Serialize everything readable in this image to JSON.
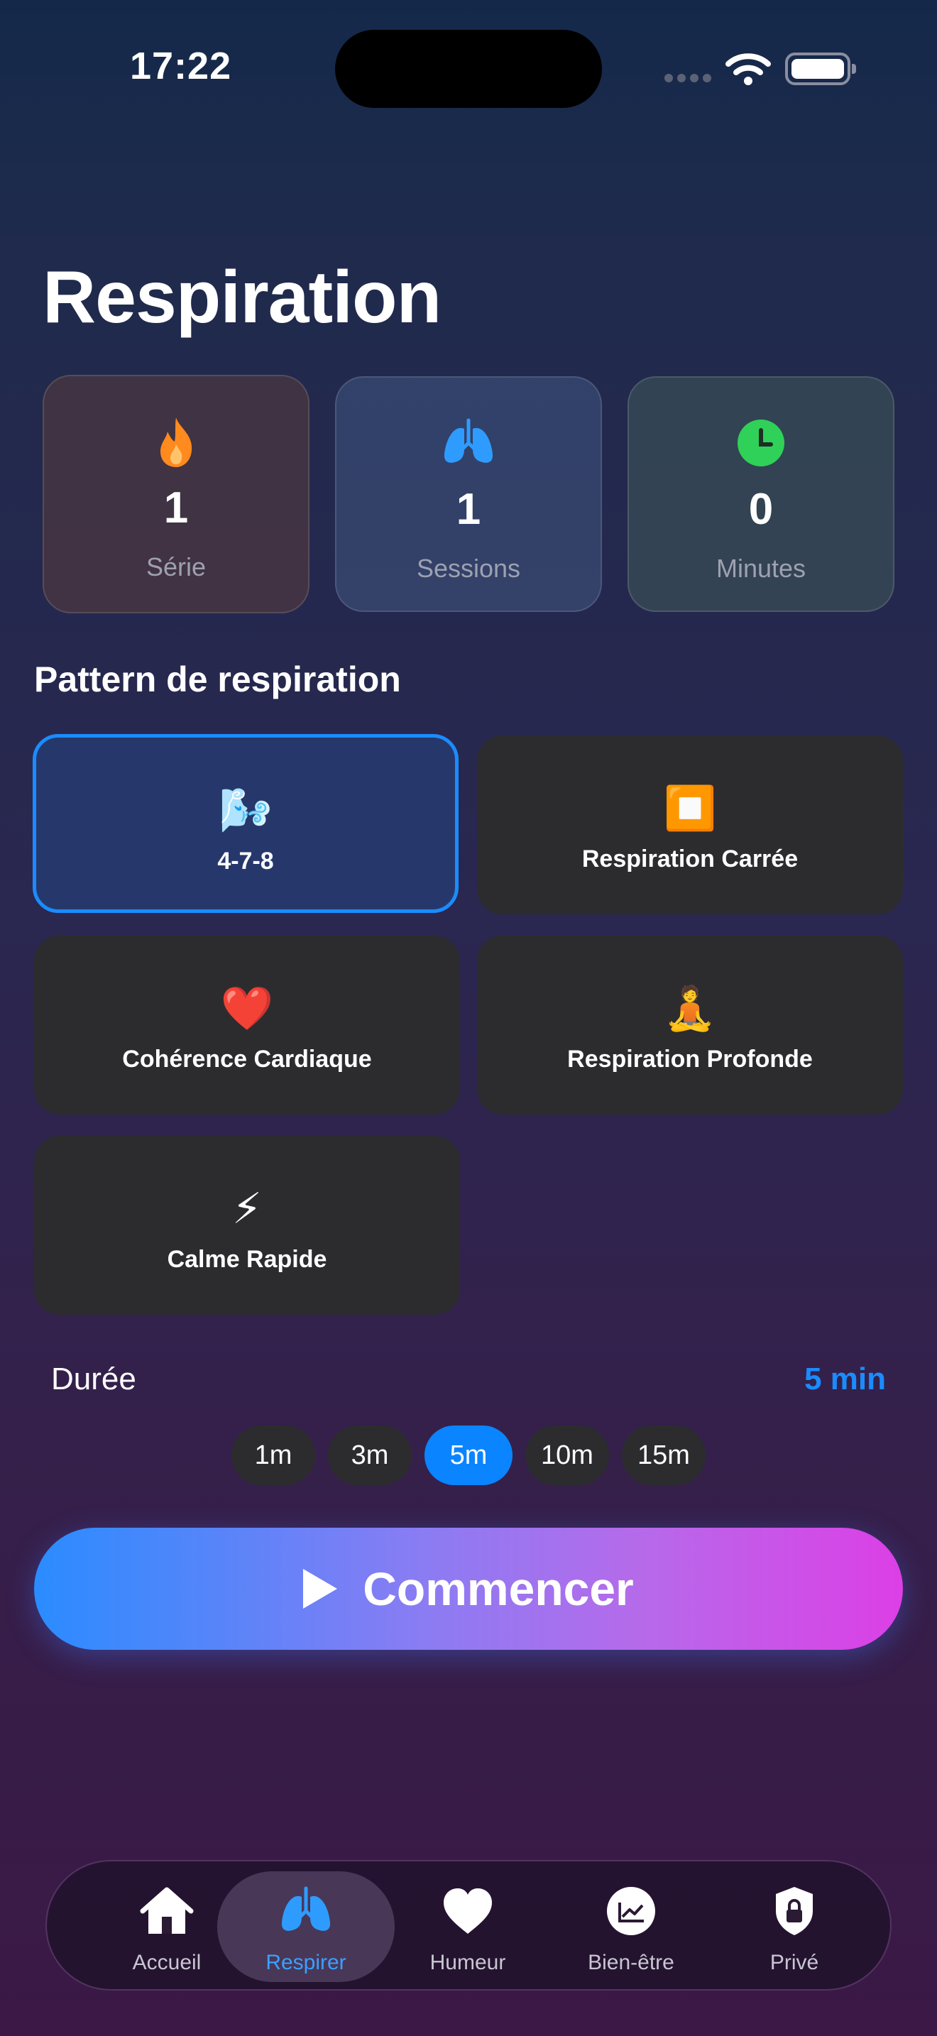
{
  "status_bar": {
    "time": "17:22"
  },
  "page": {
    "title": "Respiration"
  },
  "stats": [
    {
      "icon": "flame-icon",
      "value": "1",
      "label": "Série"
    },
    {
      "icon": "lungs-icon",
      "value": "1",
      "label": "Sessions"
    },
    {
      "icon": "clock-icon",
      "value": "0",
      "label": "Minutes"
    }
  ],
  "patterns": {
    "title": "Pattern de respiration",
    "items": [
      {
        "emoji": "🌬️",
        "label": "4-7-8",
        "selected": true
      },
      {
        "emoji": "⏹️",
        "label": "Respiration Carrée",
        "selected": false
      },
      {
        "emoji": "❤️",
        "label": "Cohérence Cardiaque",
        "selected": false
      },
      {
        "emoji": "🧘",
        "label": "Respiration Profonde",
        "selected": false
      },
      {
        "emoji": "⚡",
        "label": "Calme Rapide",
        "selected": false
      }
    ]
  },
  "duration": {
    "label": "Durée",
    "value": "5 min",
    "options": [
      "1m",
      "3m",
      "5m",
      "10m",
      "15m"
    ],
    "selected": "5m"
  },
  "start_button": {
    "label": "Commencer"
  },
  "tabbar": {
    "items": [
      {
        "icon": "house-icon",
        "label": "Accueil"
      },
      {
        "icon": "lungs-icon",
        "label": "Respirer",
        "active": true
      },
      {
        "icon": "heart-icon",
        "label": "Humeur"
      },
      {
        "icon": "chart-icon",
        "label": "Bien-être"
      },
      {
        "icon": "lock-shield-icon",
        "label": "Privé"
      }
    ]
  },
  "colors": {
    "accent": "#0a84ff",
    "selected_card": "#26386b",
    "card": "#2c2c2e"
  }
}
